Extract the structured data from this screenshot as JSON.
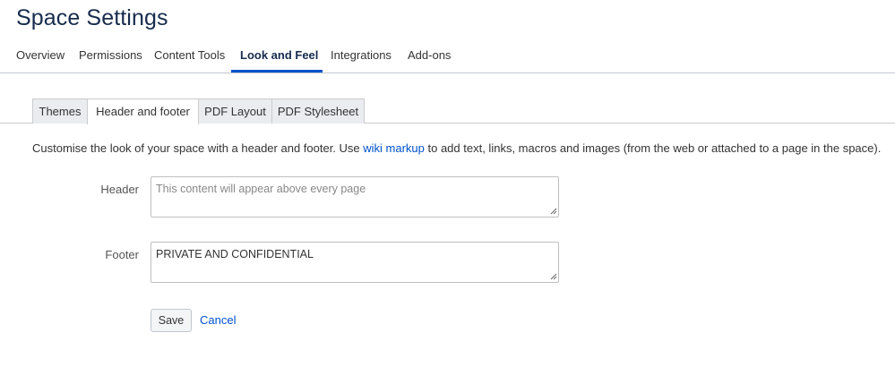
{
  "page": {
    "title": "Space Settings"
  },
  "top_nav": {
    "items": [
      {
        "label": "Overview"
      },
      {
        "label": "Permissions"
      },
      {
        "label": "Content Tools"
      },
      {
        "label": "Look and Feel",
        "active": true
      },
      {
        "label": "Integrations"
      },
      {
        "label": "Add-ons"
      }
    ]
  },
  "sub_tabs": {
    "items": [
      {
        "label": "Themes"
      },
      {
        "label": "Header and footer",
        "active": true
      },
      {
        "label": "PDF Layout"
      },
      {
        "label": "PDF Stylesheet"
      }
    ]
  },
  "description": {
    "before": "Customise the look of your space with a header and footer. Use ",
    "link": "wiki markup",
    "after": " to add text, links, macros and images (from the web or attached to a page in the space)."
  },
  "form": {
    "header": {
      "label": "Header",
      "value": "",
      "placeholder": "This content will appear above every page"
    },
    "footer": {
      "label": "Footer",
      "value": "PRIVATE AND CONFIDENTIAL",
      "placeholder": ""
    },
    "save_label": "Save",
    "cancel_label": "Cancel"
  },
  "colors": {
    "accent": "#0052cc",
    "link": "#0052cc",
    "tab_inactive_bg": "#ebecf0"
  }
}
